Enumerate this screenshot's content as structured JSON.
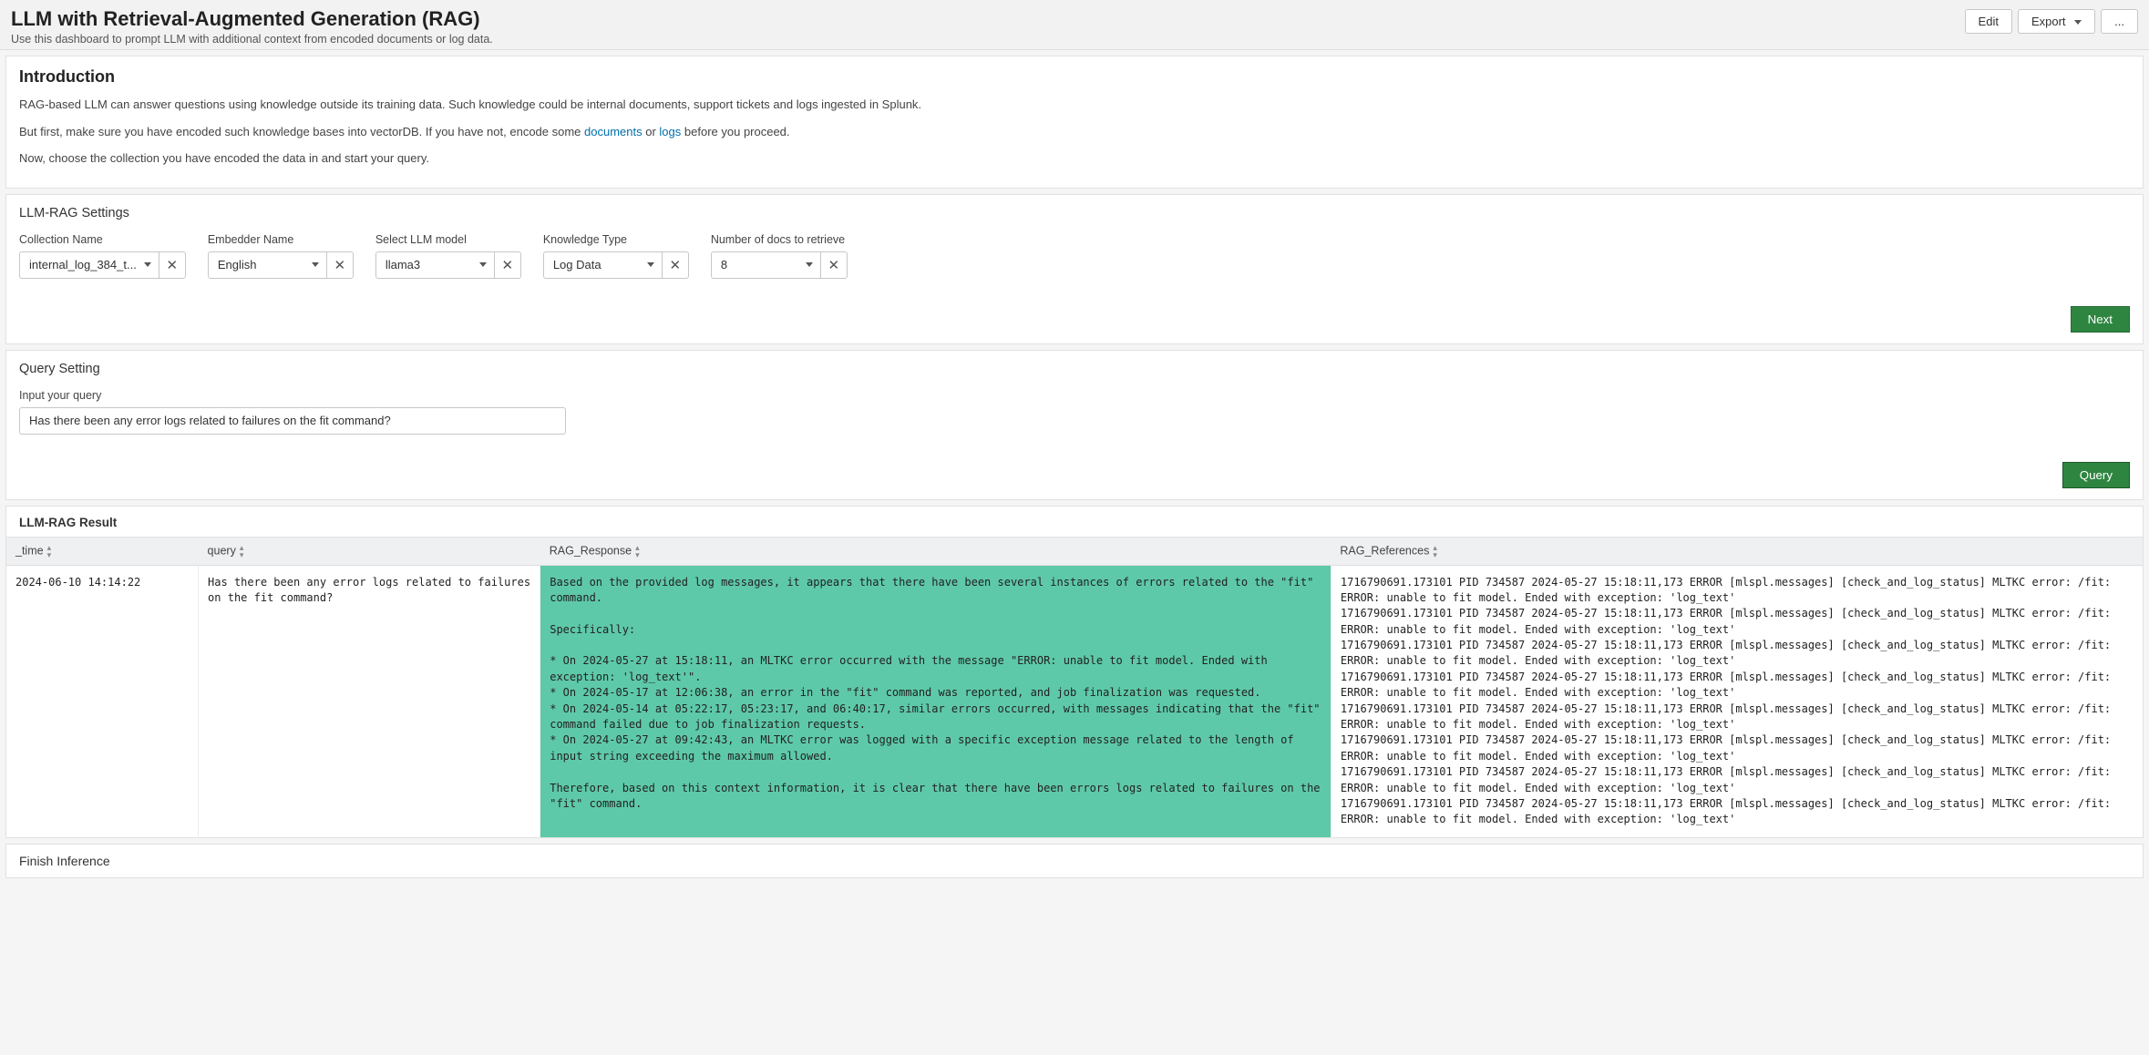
{
  "header": {
    "title": "LLM with Retrieval-Augmented Generation (RAG)",
    "subtitle": "Use this dashboard to prompt LLM with additional context from encoded documents or log data.",
    "edit_label": "Edit",
    "export_label": "Export",
    "more_label": "..."
  },
  "intro": {
    "heading": "Introduction",
    "p1": "RAG-based LLM can answer questions using knowledge outside its training data. Such knowledge could be internal documents, support tickets and logs ingested in Splunk.",
    "p2_prefix": "But first, make sure you have encoded such knowledge bases into vectorDB. If you have not, encode some ",
    "p2_link_docs": "documents",
    "p2_mid": " or ",
    "p2_link_logs": "logs",
    "p2_suffix": " before you proceed.",
    "p3": "Now, choose the collection you have encoded the data in and start your query."
  },
  "settings": {
    "heading": "LLM-RAG Settings",
    "fields": {
      "collection": {
        "label": "Collection Name",
        "value": "internal_log_384_t..."
      },
      "embedder": {
        "label": "Embedder Name",
        "value": "English"
      },
      "model": {
        "label": "Select LLM model",
        "value": "llama3"
      },
      "knowledge": {
        "label": "Knowledge Type",
        "value": "Log Data"
      },
      "numdocs": {
        "label": "Number of docs to retrieve",
        "value": "8"
      }
    },
    "next_label": "Next"
  },
  "query": {
    "heading": "Query Setting",
    "label": "Input your query",
    "value": "Has there been any error logs related to failures on the fit command?",
    "button": "Query"
  },
  "result": {
    "heading": "LLM-RAG Result",
    "columns": {
      "time": "_time",
      "query": "query",
      "response": "RAG_Response",
      "references": "RAG_References"
    },
    "row": {
      "time": "2024-06-10 14:14:22",
      "query": "Has there been any error logs related to failures on the fit command?",
      "response": "Based on the provided log messages, it appears that there have been several instances of errors related to the \"fit\" command.\n\nSpecifically:\n\n* On 2024-05-27 at 15:18:11, an MLTKC error occurred with the message \"ERROR: unable to fit model. Ended with exception: 'log_text'\".\n* On 2024-05-17 at 12:06:38, an error in the \"fit\" command was reported, and job finalization was requested.\n* On 2024-05-14 at 05:22:17, 05:23:17, and 06:40:17, similar errors occurred, with messages indicating that the \"fit\" command failed due to job finalization requests.\n* On 2024-05-27 at 09:42:43, an MLTKC error was logged with a specific exception message related to the length of input string exceeding the maximum allowed.\n\nTherefore, based on this context information, it is clear that there have been errors logs related to failures on the \"fit\" command.",
      "references": "1716790691.173101 PID 734587 2024-05-27 15:18:11,173 ERROR [mlspl.messages] [check_and_log_status] MLTKC error: /fit: ERROR: unable to fit model. Ended with exception: 'log_text'\n1716790691.173101 PID 734587 2024-05-27 15:18:11,173 ERROR [mlspl.messages] [check_and_log_status] MLTKC error: /fit: ERROR: unable to fit model. Ended with exception: 'log_text'\n1716790691.173101 PID 734587 2024-05-27 15:18:11,173 ERROR [mlspl.messages] [check_and_log_status] MLTKC error: /fit: ERROR: unable to fit model. Ended with exception: 'log_text'\n1716790691.173101 PID 734587 2024-05-27 15:18:11,173 ERROR [mlspl.messages] [check_and_log_status] MLTKC error: /fit: ERROR: unable to fit model. Ended with exception: 'log_text'\n1716790691.173101 PID 734587 2024-05-27 15:18:11,173 ERROR [mlspl.messages] [check_and_log_status] MLTKC error: /fit: ERROR: unable to fit model. Ended with exception: 'log_text'\n1716790691.173101 PID 734587 2024-05-27 15:18:11,173 ERROR [mlspl.messages] [check_and_log_status] MLTKC error: /fit: ERROR: unable to fit model. Ended with exception: 'log_text'\n1716790691.173101 PID 734587 2024-05-27 15:18:11,173 ERROR [mlspl.messages] [check_and_log_status] MLTKC error: /fit: ERROR: unable to fit model. Ended with exception: 'log_text'\n1716790691.173101 PID 734587 2024-05-27 15:18:11,173 ERROR [mlspl.messages] [check_and_log_status] MLTKC error: /fit: ERROR: unable to fit model. Ended with exception: 'log_text'"
    }
  },
  "footer": {
    "label": "Finish Inference"
  }
}
